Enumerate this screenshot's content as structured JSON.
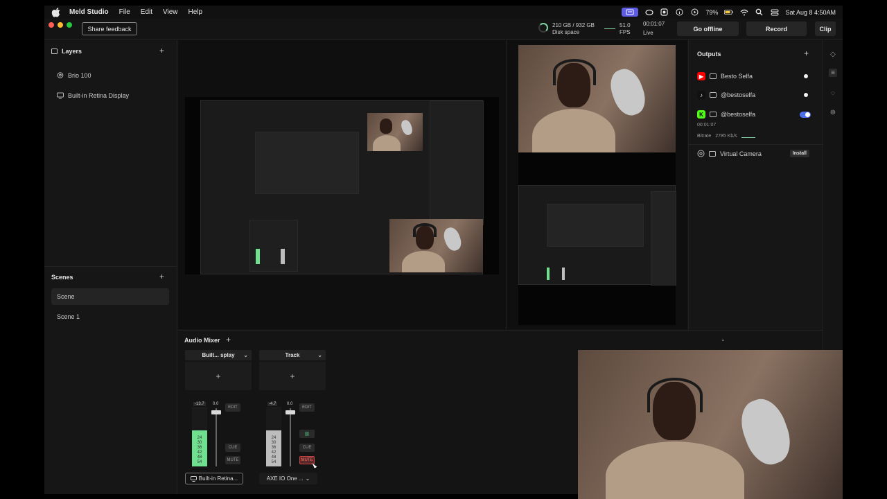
{
  "menubar": {
    "app_name": "Meld Studio",
    "menus": [
      "File",
      "Edit",
      "View",
      "Help"
    ],
    "battery": "79%",
    "clock": "Sat Aug 8  4:50AM"
  },
  "toolbar": {
    "share_feedback": "Share feedback",
    "disk_value": "210 GB / 932 GB",
    "disk_label": "Disk space",
    "fps_value": "51.0",
    "fps_label": "FPS",
    "live_time": "00:01:07",
    "live_label": "Live",
    "go_offline": "Go offline",
    "record": "Record",
    "clip": "Clip"
  },
  "layers": {
    "title": "Layers",
    "items": [
      {
        "label": "Brio 100",
        "icon": "camera-icon"
      },
      {
        "label": "Built-in Retina Display",
        "icon": "display-icon"
      }
    ]
  },
  "scenes": {
    "title": "Scenes",
    "items": [
      {
        "label": "Scene",
        "selected": true
      },
      {
        "label": "Scene 1",
        "selected": false
      }
    ]
  },
  "outputs": {
    "title": "Outputs",
    "items": [
      {
        "label": "Besto Selfa",
        "platform": "youtube",
        "color": "#ff0000"
      },
      {
        "label": "@bestoselfa",
        "platform": "tiktok",
        "color": "#111111"
      },
      {
        "label": "@bestoselfa",
        "platform": "kick",
        "color": "#53fc18"
      }
    ],
    "kick_time": "00:01:07",
    "bitrate_label": "Bitrate",
    "bitrate_value": "2785 Kb/s",
    "virtual_camera": "Virtual Camera",
    "install": "Install"
  },
  "mixer": {
    "title": "Audio Mixer",
    "strips": [
      {
        "name": "Built... splay",
        "meter_value": "-13.7",
        "fader_value": "0.0",
        "level": 0.6,
        "meter_color": "#6fe08e",
        "edit": "EDIT",
        "cue": "CUE",
        "mute": "MUTE",
        "muted": false,
        "device": "Built-in Retina..."
      },
      {
        "name": "Track",
        "meter_value": "-4.7",
        "fader_value": "0.0",
        "level": 0.6,
        "meter_color": "#bdbdbd",
        "edit": "EDIT",
        "cue": "CUE",
        "mute": "MUTE",
        "muted": true,
        "device": "AXE IO One ..."
      }
    ],
    "scale": [
      "24",
      "30",
      "36",
      "42",
      "48",
      "54"
    ]
  }
}
